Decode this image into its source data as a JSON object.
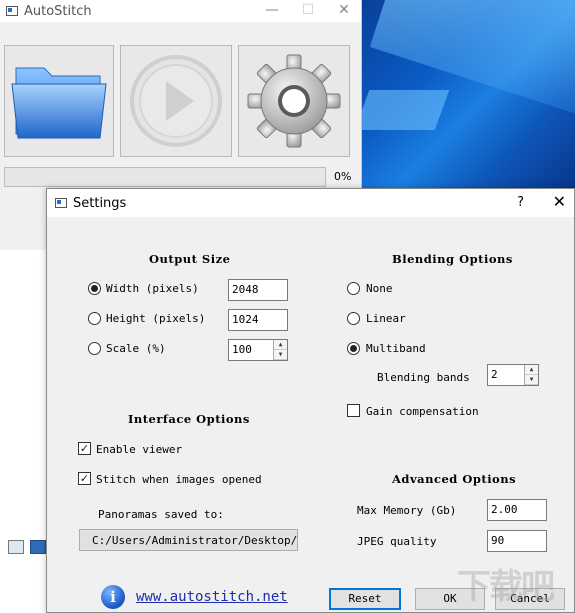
{
  "main_window": {
    "title": "AutoStitch",
    "controls": {
      "minimize": "—",
      "maximize": "☐",
      "close": "✕"
    },
    "toolbar": [
      {
        "name": "open-folder-button",
        "icon": "folder-icon"
      },
      {
        "name": "stitch-play-button",
        "icon": "play-icon"
      },
      {
        "name": "settings-gear-button",
        "icon": "gear-icon"
      }
    ],
    "progress": {
      "value": 0,
      "label": "0%"
    }
  },
  "settings": {
    "title": "Settings",
    "help": "?",
    "close": "✕",
    "output_size": {
      "heading": "Output Size",
      "options": [
        {
          "label": "Width (pixels)",
          "value": "2048",
          "selected": true
        },
        {
          "label": "Height (pixels)",
          "value": "1024",
          "selected": false
        },
        {
          "label": "Scale (%)",
          "value": "100",
          "selected": false
        }
      ]
    },
    "blending": {
      "heading": "Blending Options",
      "options": [
        {
          "label": "None",
          "selected": false
        },
        {
          "label": "Linear",
          "selected": false
        },
        {
          "label": "Multiband",
          "selected": true
        }
      ],
      "bands_label": "Blending bands",
      "bands_value": "2",
      "gain_label": "Gain compensation",
      "gain_checked": false
    },
    "interface": {
      "heading": "Interface Options",
      "enable_viewer": "Enable viewer",
      "enable_viewer_checked": true,
      "stitch_when_opened": "Stitch when images opened",
      "stitch_when_opened_checked": true,
      "saved_to_label": "Panoramas saved to:",
      "saved_to_path": "C:/Users/Administrator/Desktop/"
    },
    "advanced": {
      "heading": "Advanced Options",
      "max_memory_label": "Max Memory (Gb)",
      "max_memory_value": "2.00",
      "jpeg_quality_label": "JPEG quality",
      "jpeg_quality_value": "90"
    },
    "link": "www.autostitch.net",
    "buttons": {
      "reset": "Reset",
      "ok": "OK",
      "cancel": "Cancel"
    }
  },
  "watermark": "下载吧",
  "colors": {
    "accent": "#0078d7",
    "link": "#1d2fa8",
    "desktop_blue": "#0b5cc5"
  }
}
